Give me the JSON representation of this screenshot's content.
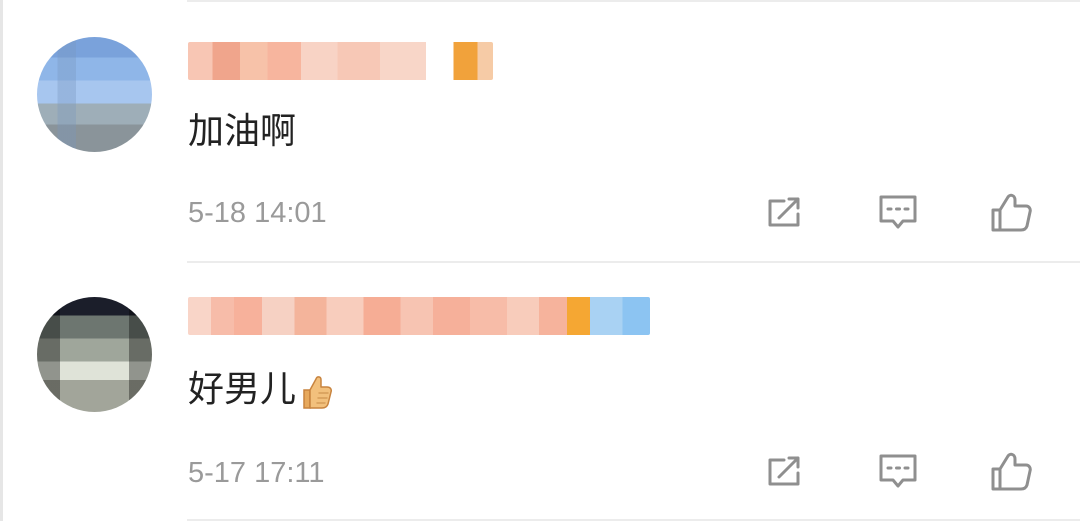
{
  "comments": [
    {
      "text": "加油啊",
      "timestamp": "5-18 14:01"
    },
    {
      "text": "好男儿",
      "timestamp": "5-17 17:11",
      "emoji": "thumbs-up-emoji"
    }
  ],
  "icons": {
    "share": "share-icon",
    "reply": "comment-icon",
    "like": "thumbs-up-icon"
  },
  "colors": {
    "text": "#222222",
    "muted": "#9a9a9a",
    "divider": "#ececec",
    "icon": "#8f8f8f"
  }
}
